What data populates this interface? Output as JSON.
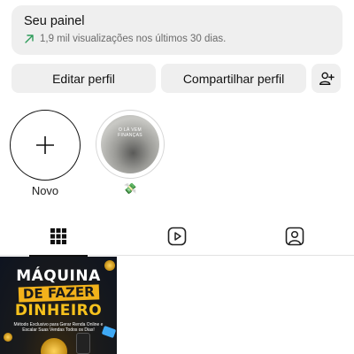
{
  "panel": {
    "title": "Seu painel",
    "subtitle": "1,9 mil visualizações nos últimos 30 dias."
  },
  "actions": {
    "edit_label": "Editar perfil",
    "share_label": "Compartilhar perfil",
    "add_person_icon": "add-person-icon"
  },
  "highlights": {
    "new_label": "Novo",
    "items": [
      {
        "caption": "O LÁ VEM FINANÇAS",
        "label_emoji": "💸"
      }
    ]
  },
  "tabs": [
    {
      "name": "grid",
      "icon": "grid-icon",
      "active": true
    },
    {
      "name": "reels",
      "icon": "reels-icon",
      "active": false
    },
    {
      "name": "tagged",
      "icon": "tagged-icon",
      "active": false
    }
  ],
  "posts": [
    {
      "line1": "MÁQUINA",
      "line2": "DE FAZER",
      "line3": "DINHEIRO",
      "line4": "Método Exclusivo para Gerar Renda Online e Escalar Suas Vendas Todos os Dias!"
    }
  ],
  "colors": {
    "panel_bg": "#efefef",
    "trend_arrow": "#2e9c5a",
    "post_accent": "#f2b21b"
  }
}
